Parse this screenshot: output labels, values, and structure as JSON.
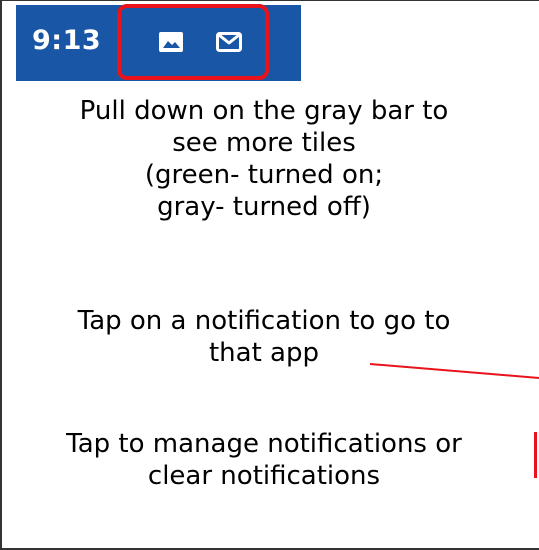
{
  "status_bar": {
    "time": "9:13",
    "bg_color": "#1a56a6",
    "icons": [
      "image-icon",
      "mail-icon"
    ],
    "highlight_color": "#e8131b"
  },
  "instructions": {
    "block1": {
      "lines": [
        "Pull down on the gray bar to",
        "see more tiles",
        "(green- turned on;",
        "gray- turned off)"
      ]
    },
    "block2": {
      "lines": [
        "Tap on a notification to go to",
        "that app"
      ]
    },
    "block3": {
      "lines": [
        "Tap to manage notifications or",
        "clear notifications"
      ]
    }
  }
}
